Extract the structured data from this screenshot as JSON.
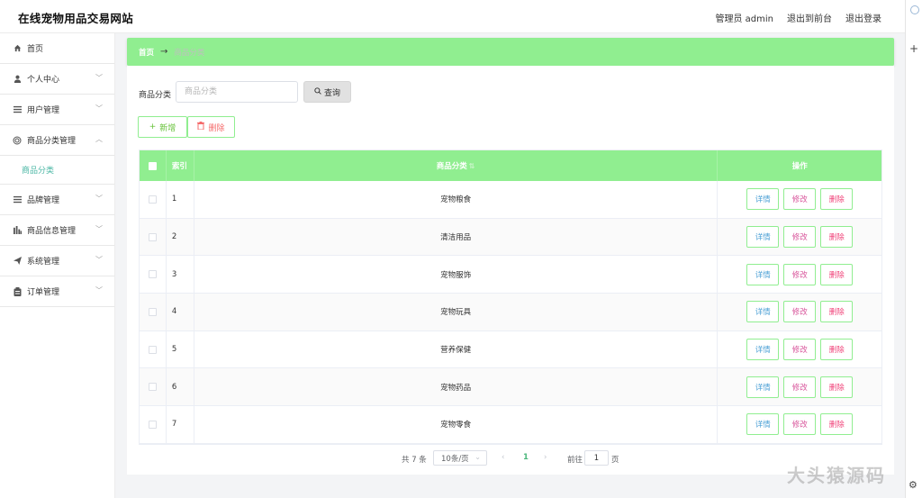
{
  "app": {
    "title": "在线宠物用品交易网站",
    "header_links": [
      "管理员 admin",
      "退出到前台",
      "退出登录"
    ]
  },
  "sidebar": {
    "items": [
      {
        "label": "首页",
        "icon": "home-icon",
        "chevron": ""
      },
      {
        "label": "个人中心",
        "icon": "user-icon",
        "chevron": "﹀"
      },
      {
        "label": "用户管理",
        "icon": "list-icon",
        "chevron": "﹀"
      },
      {
        "label": "商品分类管理",
        "icon": "circle-icon",
        "chevron": "︿"
      },
      {
        "label": "品牌管理",
        "icon": "list-icon",
        "chevron": "﹀"
      },
      {
        "label": "商品信息管理",
        "icon": "chart-icon",
        "chevron": "﹀"
      },
      {
        "label": "系统管理",
        "icon": "send-icon",
        "chevron": "﹀"
      },
      {
        "label": "订单管理",
        "icon": "clipboard-icon",
        "chevron": "﹀"
      }
    ],
    "active_submenu": "商品分类"
  },
  "breadcrumb": {
    "home": "首页",
    "current": "商品分类"
  },
  "search": {
    "label": "商品分类",
    "placeholder": "商品分类",
    "button": "查询"
  },
  "toolbar": {
    "add_label": "新增",
    "delete_label": "删除"
  },
  "table": {
    "headers": {
      "index": "索引",
      "category": "商品分类",
      "actions": "操作"
    },
    "rows": [
      {
        "index": "1",
        "category": "宠物粮食"
      },
      {
        "index": "2",
        "category": "清洁用品"
      },
      {
        "index": "3",
        "category": "宠物服饰"
      },
      {
        "index": "4",
        "category": "宠物玩具"
      },
      {
        "index": "5",
        "category": "营养保健"
      },
      {
        "index": "6",
        "category": "宠物药品"
      },
      {
        "index": "7",
        "category": "宠物零食"
      }
    ],
    "row_actions": {
      "detail": "详情",
      "edit": "修改",
      "delete": "删除"
    }
  },
  "pagination": {
    "total": "共 7 条",
    "page_size": "10条/页",
    "current_page": "1",
    "goto_label": "前往",
    "goto_value": "1",
    "page_suffix": "页"
  },
  "watermark": "大头猿源码",
  "colors": {
    "accent_green": "#90ee90",
    "active_text": "#4cb7a5",
    "detail": "#4fa2d6",
    "edit": "#d8559b",
    "delete": "#f0447a"
  }
}
